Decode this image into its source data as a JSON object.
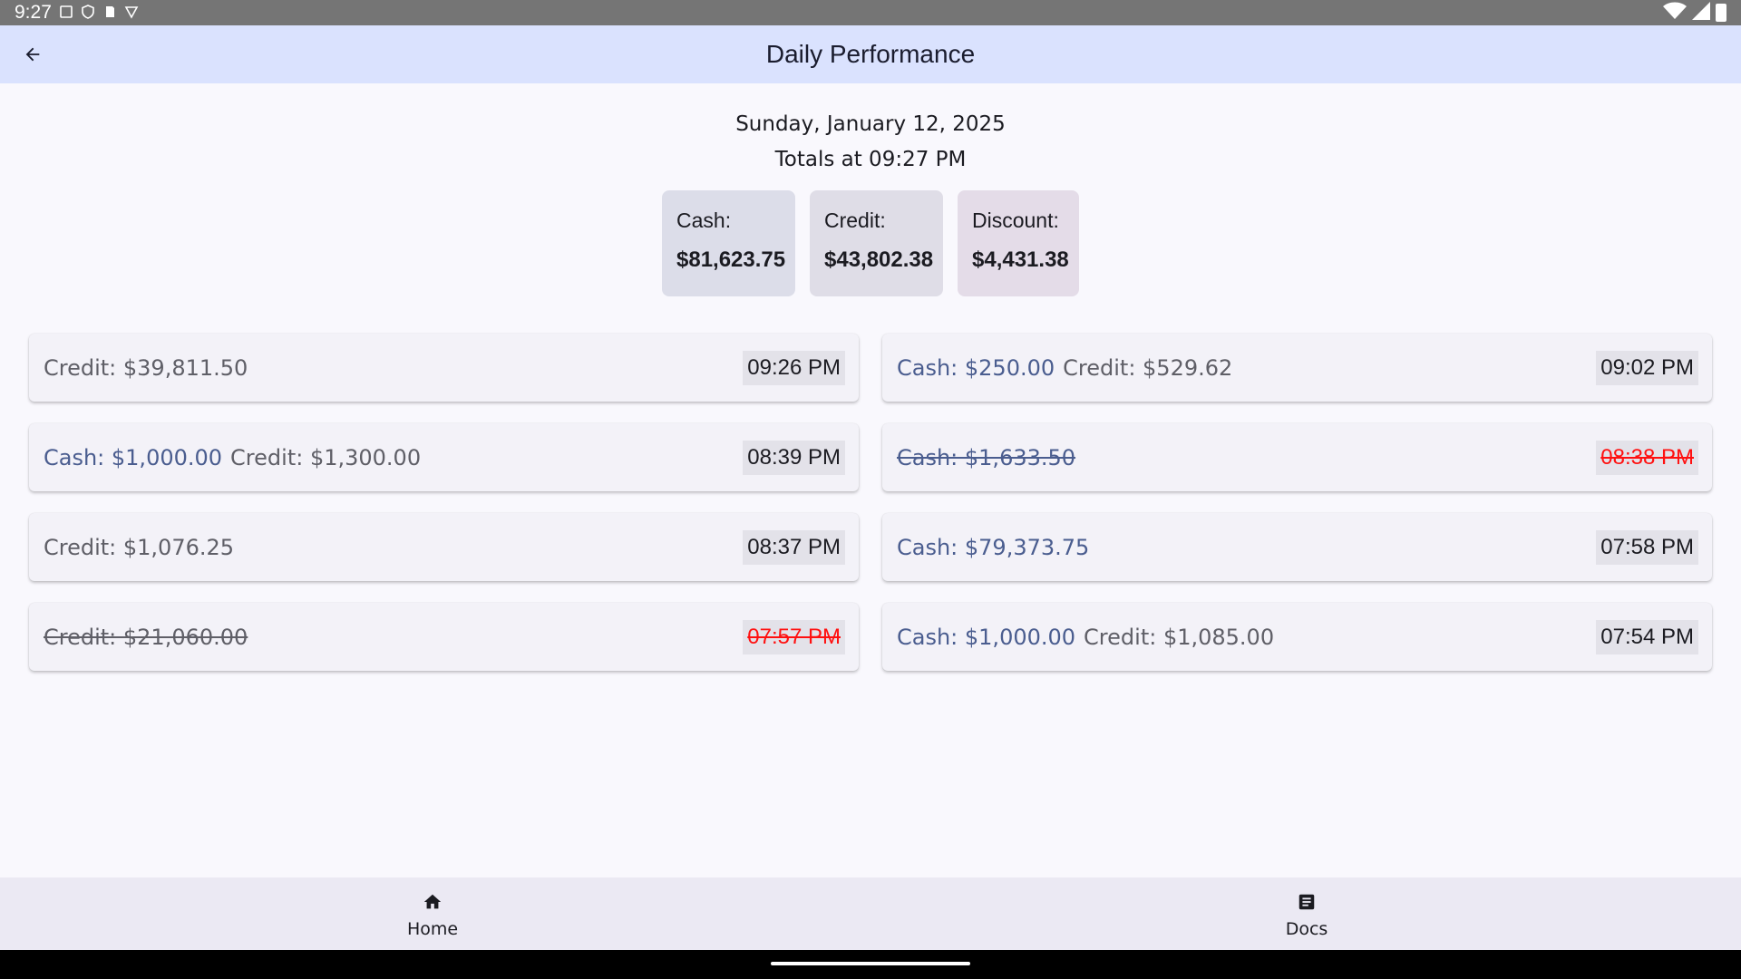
{
  "status_bar": {
    "time": "9:27",
    "icons_left": [
      "screenshot-icon",
      "shield-icon",
      "sd-card-icon",
      "vpn-icon"
    ],
    "icons_right": [
      "wifi-icon",
      "signal-icon",
      "battery-icon"
    ]
  },
  "app_bar": {
    "title": "Daily Performance",
    "back_icon": "arrow-back-icon"
  },
  "header": {
    "date": "Sunday, January 12, 2025",
    "totals_label": "Totals at 09:27 PM"
  },
  "summary": {
    "cash": {
      "label": "Cash:",
      "value": "$81,623.75"
    },
    "credit": {
      "label": "Credit:",
      "value": "$43,802.38"
    },
    "discount": {
      "label": "Discount:",
      "value": "$4,431.38"
    }
  },
  "entries": [
    {
      "cash": "",
      "credit": "Credit: $39,811.50",
      "time": "09:26 PM",
      "voided": false
    },
    {
      "cash": "Cash: $250.00",
      "credit": "Credit: $529.62",
      "time": "09:02 PM",
      "voided": false
    },
    {
      "cash": "Cash: $1,000.00",
      "credit": "Credit: $1,300.00",
      "time": "08:39 PM",
      "voided": false
    },
    {
      "cash": "Cash: $1,633.50",
      "credit": "",
      "time": "08:38 PM",
      "voided": true
    },
    {
      "cash": "",
      "credit": "Credit: $1,076.25",
      "time": "08:37 PM",
      "voided": false
    },
    {
      "cash": "Cash: $79,373.75",
      "credit": "",
      "time": "07:58 PM",
      "voided": false
    },
    {
      "cash": "",
      "credit": "Credit: $21,060.00",
      "time": "07:57 PM",
      "voided": true
    },
    {
      "cash": "Cash: $1,000.00",
      "credit": "Credit: $1,085.00",
      "time": "07:54 PM",
      "voided": false
    }
  ],
  "bottom_nav": {
    "home": {
      "label": "Home",
      "icon": "home-icon"
    },
    "docs": {
      "label": "Docs",
      "icon": "docs-icon"
    }
  },
  "colors": {
    "app_bar": "#dae2fe",
    "background": "#f9f8fd",
    "cash_text": "#4a5d8f",
    "credit_text": "#5f5f67",
    "voided_time": "#ff1010"
  }
}
